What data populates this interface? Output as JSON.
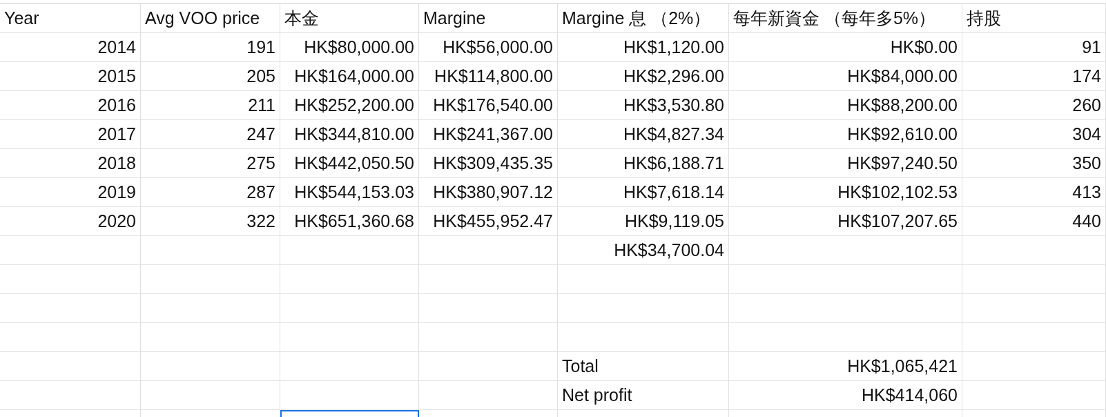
{
  "columns": [
    "Year",
    "Avg VOO price",
    "本金",
    "Margine",
    "Margine 息 （2%）",
    "每年新資金 （每年多5%）",
    "持股"
  ],
  "rows": [
    {
      "kind": "data",
      "cells": [
        "2014",
        "191",
        "HK$80,000.00",
        "HK$56,000.00",
        "HK$1,120.00",
        "HK$0.00",
        "91"
      ]
    },
    {
      "kind": "data",
      "cells": [
        "2015",
        "205",
        "HK$164,000.00",
        "HK$114,800.00",
        "HK$2,296.00",
        "HK$84,000.00",
        "174"
      ]
    },
    {
      "kind": "data",
      "cells": [
        "2016",
        "211",
        "HK$252,200.00",
        "HK$176,540.00",
        "HK$3,530.80",
        "HK$88,200.00",
        "260"
      ]
    },
    {
      "kind": "data",
      "cells": [
        "2017",
        "247",
        "HK$344,810.00",
        "HK$241,367.00",
        "HK$4,827.34",
        "HK$92,610.00",
        "304"
      ]
    },
    {
      "kind": "data",
      "cells": [
        "2018",
        "275",
        "HK$442,050.50",
        "HK$309,435.35",
        "HK$6,188.71",
        "HK$97,240.50",
        "350"
      ]
    },
    {
      "kind": "data",
      "cells": [
        "2019",
        "287",
        "HK$544,153.03",
        "HK$380,907.12",
        "HK$7,618.14",
        "HK$102,102.53",
        "413"
      ]
    },
    {
      "kind": "data",
      "cells": [
        "2020",
        "322",
        "HK$651,360.68",
        "HK$455,952.47",
        "HK$9,119.05",
        "HK$107,207.65",
        "440"
      ]
    },
    {
      "kind": "data",
      "cells": [
        null,
        null,
        null,
        null,
        "HK$34,700.04",
        null,
        null
      ]
    },
    {
      "kind": "blank"
    },
    {
      "kind": "blank"
    },
    {
      "kind": "blank"
    },
    {
      "kind": "summary",
      "cells": [
        null,
        null,
        null,
        null,
        "Total",
        "HK$1,065,421",
        null
      ]
    },
    {
      "kind": "summary",
      "cells": [
        null,
        null,
        null,
        null,
        "Net profit",
        "HK$414,060",
        null
      ]
    }
  ],
  "last_row": [
    {
      "selected": false
    },
    {
      "selected": false
    },
    {
      "selected": true
    },
    {
      "selected": false
    },
    {
      "selected": false
    },
    {
      "selected": false
    },
    {
      "selected": false
    }
  ]
}
